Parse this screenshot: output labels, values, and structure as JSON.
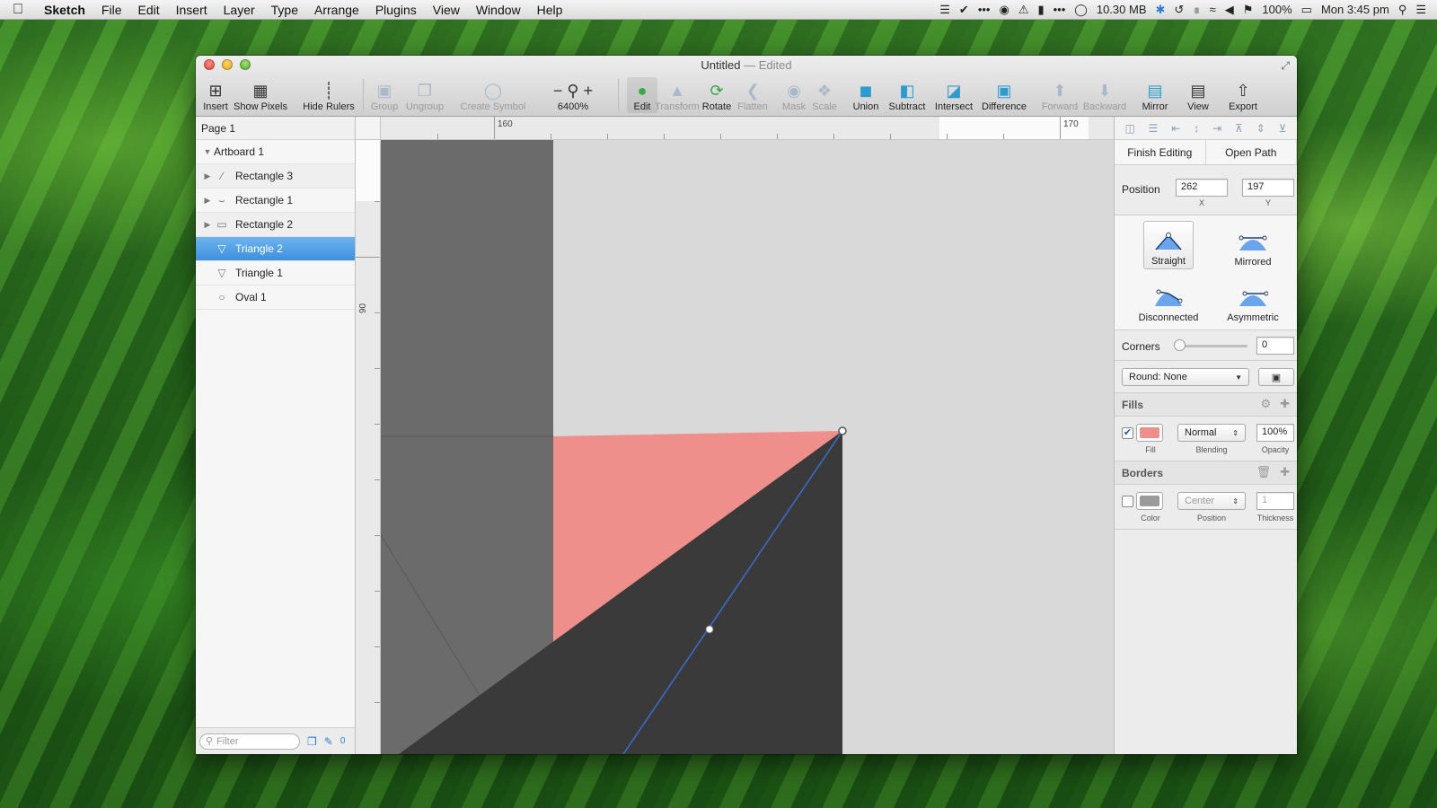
{
  "menubar": {
    "app_name": "Sketch",
    "items": [
      "File",
      "Edit",
      "Insert",
      "Layer",
      "Type",
      "Arrange",
      "Plugins",
      "View",
      "Window",
      "Help"
    ],
    "memory": "10.30 MB",
    "battery": "100%",
    "clock": "Mon 3:45 pm"
  },
  "window": {
    "title": "Untitled",
    "title_suffix": "— Edited"
  },
  "toolbar": {
    "insert": "Insert",
    "show_pixels": "Show Pixels",
    "hide_rulers": "Hide Rulers",
    "group": "Group",
    "ungroup": "Ungroup",
    "create_symbol": "Create Symbol",
    "zoom_value": "6400%",
    "edit": "Edit",
    "transform": "Transform",
    "rotate": "Rotate",
    "flatten": "Flatten",
    "mask": "Mask",
    "scale": "Scale",
    "union": "Union",
    "subtract": "Subtract",
    "intersect": "Intersect",
    "difference": "Difference",
    "forward": "Forward",
    "backward": "Backward",
    "mirror": "Mirror",
    "view": "View",
    "export": "Export"
  },
  "layers": {
    "page": "Page 1",
    "artboard": "Artboard 1",
    "items": [
      {
        "label": "Rectangle 3"
      },
      {
        "label": "Rectangle 1"
      },
      {
        "label": "Rectangle 2"
      },
      {
        "label": "Triangle 2"
      },
      {
        "label": "Triangle 1"
      },
      {
        "label": "Oval 1"
      }
    ],
    "filter_placeholder": "Filter",
    "footer_count": "0"
  },
  "rulers": {
    "top_label_1": "160",
    "top_label_2": "170",
    "left_label": "90"
  },
  "inspector": {
    "finish_editing": "Finish Editing",
    "open_path": "Open Path",
    "position_label": "Position",
    "x_value": "262",
    "y_value": "197",
    "x_label": "X",
    "y_label": "Y",
    "point_types": [
      "Straight",
      "Mirrored",
      "Disconnected",
      "Asymmetric"
    ],
    "corners_label": "Corners",
    "corners_value": "0",
    "round_value": "Round: None",
    "fills_title": "Fills",
    "fill_blending": "Normal",
    "fill_opacity": "100%",
    "fill_label": "Fill",
    "blending_label": "Blending",
    "opacity_label": "Opacity",
    "borders_title": "Borders",
    "border_position": "Center",
    "border_thickness": "1",
    "color_label": "Color",
    "position_sub_label": "Position",
    "thickness_label": "Thickness"
  },
  "colors": {
    "fill": "#ef8f8b",
    "border": "#9b9b9b",
    "selection": "#4a96df",
    "path": "#3a6fd0"
  }
}
